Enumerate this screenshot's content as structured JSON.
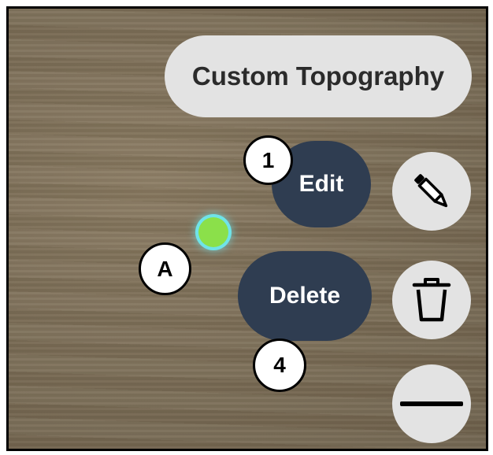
{
  "menu": {
    "title": "Custom Topography",
    "edit_label": "Edit",
    "delete_label": "Delete"
  },
  "side_buttons": {
    "edit_icon": "pencil-icon",
    "delete_icon": "trash-icon",
    "collapse_icon": "minus-icon"
  },
  "annotations": {
    "marker_1": "1",
    "marker_a": "A",
    "marker_4": "4"
  },
  "point": {
    "fill_color": "#8be04a",
    "halo_color": "#6fe3e9"
  },
  "colors": {
    "pill_dark": "#2f3d51",
    "pill_light": "#e3e3e3"
  }
}
